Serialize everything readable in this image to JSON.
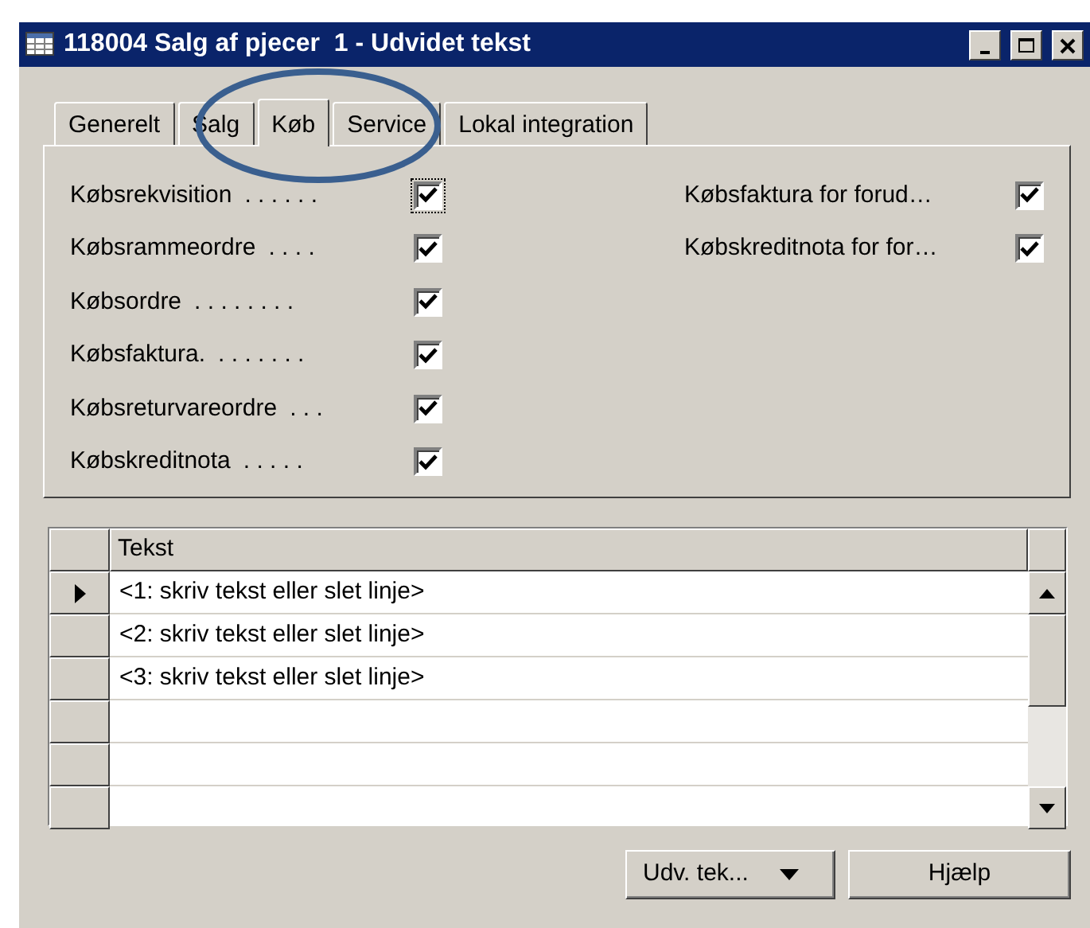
{
  "window": {
    "title": "118004 Salg af pjecer  1 - Udvidet tekst"
  },
  "tabs": [
    {
      "label": "Generelt",
      "selected": false
    },
    {
      "label": "Salg",
      "selected": false
    },
    {
      "label": "Køb",
      "selected": true
    },
    {
      "label": "Service",
      "selected": false
    },
    {
      "label": "Lokal integration",
      "selected": false
    }
  ],
  "left_options": [
    {
      "label": "Købsrekvisition",
      "leader": ". . . . . .",
      "checked": true,
      "focused": true
    },
    {
      "label": "Købsrammeordre",
      "leader": ". . . .",
      "checked": true,
      "focused": false
    },
    {
      "label": "Købsordre",
      "leader": ". . . . . . . .",
      "checked": true,
      "focused": false
    },
    {
      "label": "Købsfaktura.",
      "leader": ". . . . . . .",
      "checked": true,
      "focused": false
    },
    {
      "label": "Købsreturvareordre",
      "leader": ". . .",
      "checked": true,
      "focused": false
    },
    {
      "label": "Købskreditnota",
      "leader": ". . . . .",
      "checked": true,
      "focused": false
    }
  ],
  "right_options": [
    {
      "label": "Købsfaktura for forud…",
      "checked": true
    },
    {
      "label": "Købskreditnota for for…",
      "checked": true
    }
  ],
  "table": {
    "columns": [
      "Tekst"
    ],
    "rows": [
      {
        "text": "<1: skriv tekst eller slet linje>",
        "current": true
      },
      {
        "text": "<2: skriv tekst eller slet linje>",
        "current": false
      },
      {
        "text": "<3: skriv tekst eller slet linje>",
        "current": false
      },
      {
        "current": false
      },
      {
        "current": false
      },
      {
        "current": false
      }
    ]
  },
  "buttons": [
    {
      "label": "Udv. tek...",
      "kind": "dropdown"
    },
    {
      "label": "Hjælp",
      "kind": "plain"
    }
  ]
}
